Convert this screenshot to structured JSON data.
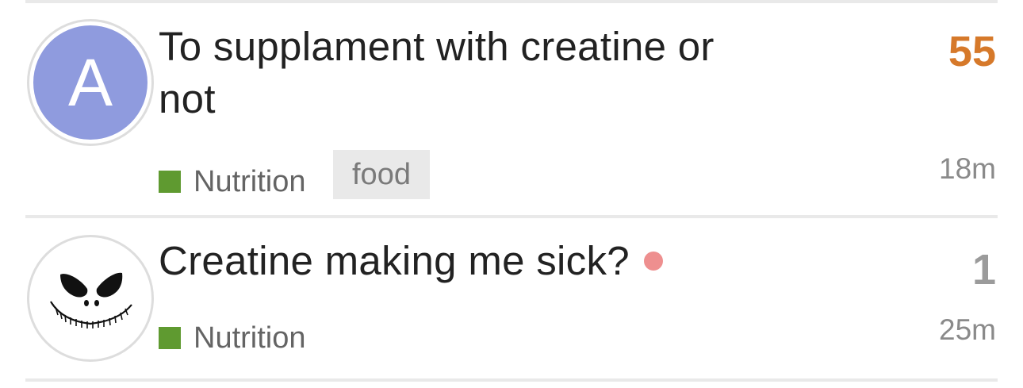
{
  "colors": {
    "divider": "#e9e9e9",
    "category_nutrition": "#5f9a30",
    "hot_count": "#d6792a",
    "normal_count": "#9b9b9b",
    "unread_dot": "#ee8f8f",
    "avatar_a_bg": "#8f9bde"
  },
  "topics": [
    {
      "avatar": {
        "type": "letter",
        "letter": "A",
        "background": "#8f9bde"
      },
      "title": "To supplament with creatine or not",
      "category": "Nutrition",
      "tag": "food",
      "replies": "55",
      "replies_color": "#d6792a",
      "activity": "18m",
      "unread": false
    },
    {
      "avatar": {
        "type": "image",
        "icon": "skull-face-icon"
      },
      "title": "Creatine making me sick?",
      "category": "Nutrition",
      "replies": "1",
      "replies_color": "#9b9b9b",
      "activity": "25m",
      "unread": true
    }
  ]
}
